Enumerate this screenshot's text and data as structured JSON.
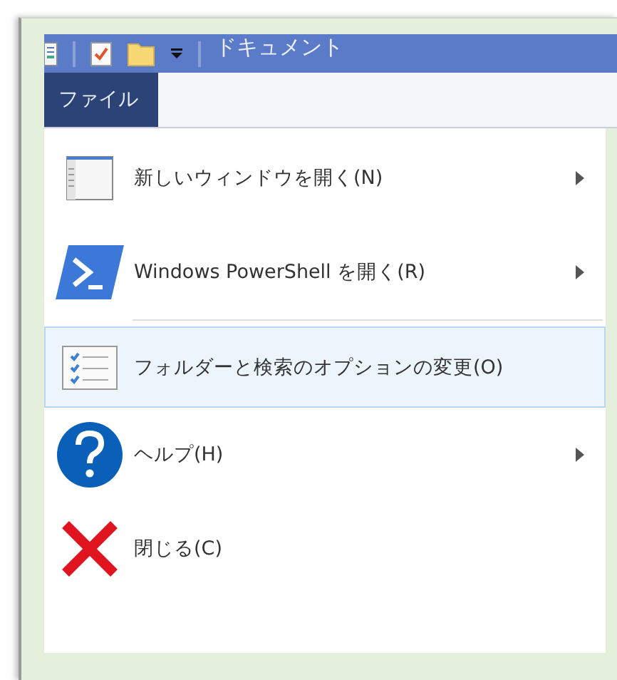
{
  "window": {
    "title": "ドキュメント"
  },
  "tabs": [
    {
      "label": "ファイル",
      "selected": true
    }
  ],
  "menu": [
    {
      "kind": "window",
      "label": "新しいウィンドウを開く(N)",
      "submenu": true,
      "selected": false,
      "separator_after": false
    },
    {
      "kind": "powershell",
      "label": "Windows PowerShell を開く(R)",
      "submenu": true,
      "selected": false,
      "separator_after": true
    },
    {
      "kind": "options",
      "label": "フォルダーと検索のオプションの変更(O)",
      "submenu": false,
      "selected": true,
      "separator_after": false
    },
    {
      "kind": "help",
      "label": "ヘルプ(H)",
      "submenu": true,
      "selected": false,
      "separator_after": false
    },
    {
      "kind": "close",
      "label": "閉じる(C)",
      "submenu": false,
      "selected": false,
      "separator_after": false
    }
  ]
}
